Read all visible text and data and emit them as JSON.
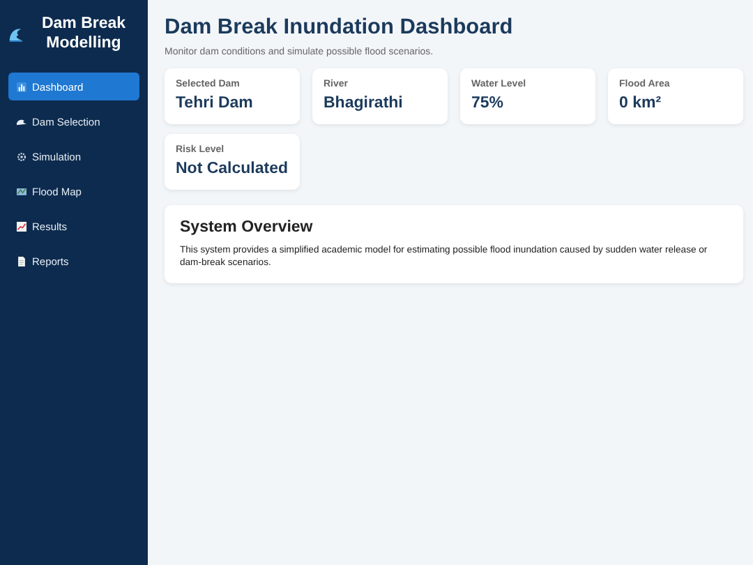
{
  "sidebar": {
    "title": "Dam Break Modelling",
    "items": [
      {
        "label": "Dashboard",
        "selected": true
      },
      {
        "label": "Dam Selection",
        "selected": false
      },
      {
        "label": "Simulation",
        "selected": false
      },
      {
        "label": "Flood Map",
        "selected": false
      },
      {
        "label": "Results",
        "selected": false
      },
      {
        "label": "Reports",
        "selected": false
      }
    ]
  },
  "header": {
    "title": "Dam Break Inundation Dashboard",
    "subtitle": "Monitor dam conditions and simulate possible flood scenarios."
  },
  "stats": [
    {
      "label": "Selected Dam",
      "value": "Tehri Dam"
    },
    {
      "label": "River",
      "value": "Bhagirathi"
    },
    {
      "label": "Water Level",
      "value": "75%"
    },
    {
      "label": "Flood Area",
      "value": "0 km²"
    },
    {
      "label": "Risk Level",
      "value": "Not Calculated"
    }
  ],
  "overview": {
    "title": "System Overview",
    "text": "This system provides a simplified academic model for estimating possible flood inundation caused by sudden water release or dam-break scenarios."
  }
}
